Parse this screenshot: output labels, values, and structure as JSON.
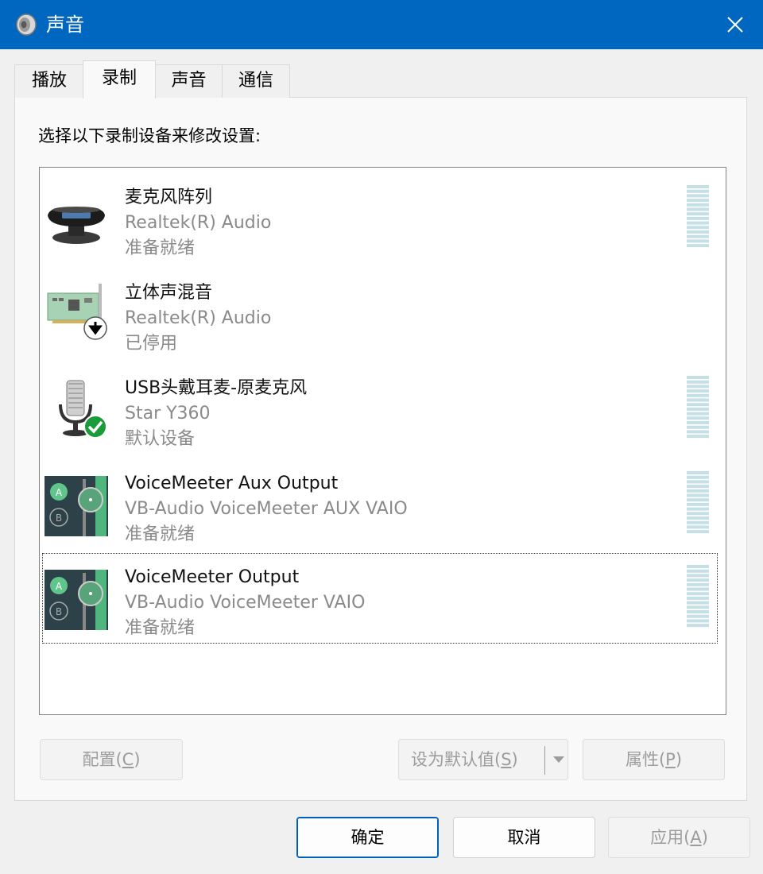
{
  "window": {
    "title": "声音"
  },
  "tabs": [
    {
      "label": "播放"
    },
    {
      "label": "录制"
    },
    {
      "label": "声音"
    },
    {
      "label": "通信"
    }
  ],
  "instruction": "选择以下录制设备来修改设置:",
  "devices": [
    {
      "name": "麦克风阵列",
      "driver": "Realtek(R) Audio",
      "status": "准备就绪",
      "icon": "microphone-array-icon"
    },
    {
      "name": "立体声混音",
      "driver": "Realtek(R) Audio",
      "status": "已停用",
      "icon": "sound-card-icon"
    },
    {
      "name": "USB头戴耳麦-原麦克风",
      "driver": "Star Y360",
      "status": "默认设备",
      "icon": "usb-microphone-icon"
    },
    {
      "name": "VoiceMeeter Aux Output",
      "driver": "VB-Audio VoiceMeeter AUX VAIO",
      "status": "准备就绪",
      "icon": "voicemeeter-icon"
    },
    {
      "name": "VoiceMeeter Output",
      "driver": "VB-Audio VoiceMeeter VAIO",
      "status": "准备就绪",
      "icon": "voicemeeter-icon"
    }
  ],
  "buttons": {
    "configure": {
      "label": "配置(",
      "key": "C",
      "suffix": ")"
    },
    "set_default": {
      "label": "设为默认值(",
      "key": "S",
      "suffix": ")"
    },
    "properties": {
      "label": "属性(",
      "key": "P",
      "suffix": ")"
    },
    "ok": "确定",
    "cancel": "取消",
    "apply": {
      "label": "应用(",
      "key": "A",
      "suffix": ")"
    }
  },
  "colors": {
    "titlebar": "#0067c0",
    "meter": "#c5dfe6",
    "default_badge": "#1a9c3a",
    "primary_border": "#005fb8"
  }
}
